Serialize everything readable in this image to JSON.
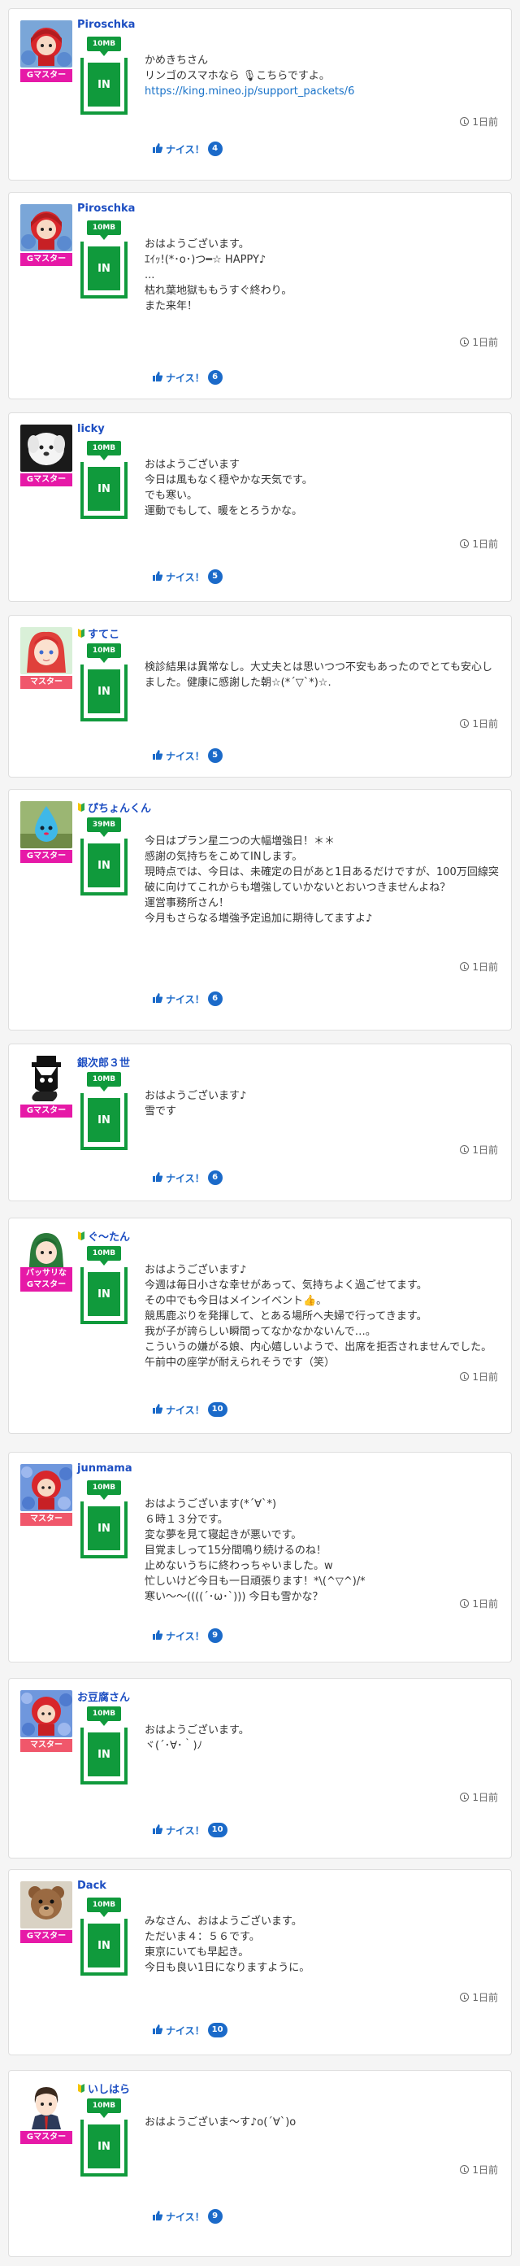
{
  "posts": [
    {
      "user": "Piroschka",
      "rank": "Gマスター",
      "packet": "10MB",
      "packet_in": "IN",
      "text": "かめきちさん\nリンゴのスマホなら 🎙こちらですよ。",
      "link": "https://king.mineo.jp/support_packets/6",
      "time": "1日前",
      "nice_label": "ナイス！",
      "nice_count": "4",
      "avatar": "red-hood-girl"
    },
    {
      "user": "Piroschka",
      "rank": "Gマスター",
      "packet": "10MB",
      "packet_in": "IN",
      "text": "おはようございます。\nｴｲｯ!(*･o･)つ━☆ HAPPY♪\n...\n枯れ葉地獄ももうすぐ終わり。\nまた来年！",
      "time": "1日前",
      "nice_label": "ナイス！",
      "nice_count": "6",
      "avatar": "red-hood-girl"
    },
    {
      "user": "licky",
      "rank": "Gマスター",
      "packet": "10MB",
      "packet_in": "IN",
      "text": "おはようございます\n今日は風もなく穏やかな天気です。\nでも寒い。\n運動でもして、暖をとろうかな。",
      "time": "1日前",
      "nice_label": "ナイス！",
      "nice_count": "5",
      "avatar": "white-dog"
    },
    {
      "user": "すてこ",
      "rank": "マスター",
      "packet": "10MB",
      "packet_in": "IN",
      "beginner": true,
      "text": "検診結果は異常なし。大丈夫とは思いつつ不安もあったのでとても安心しました。健康に感謝した朝☆(*´▽`*)☆.",
      "time": "1日前",
      "nice_label": "ナイス！",
      "nice_count": "5",
      "avatar": "red-hair-girl"
    },
    {
      "user": "ぴちょんくん",
      "rank": "Gマスター",
      "packet": "39MB",
      "packet_in": "IN",
      "beginner": true,
      "text": "今日はプラン星二つの大幅増強日！＊＊\n感謝の気持ちをこめてINします。\n現時点では、今日は、未確定の日があと1日あるだけですが、100万回線突破に向けてこれからも増強していかないとおいつきませんよね？\n運営事務所さん！\n今月もさらなる増強予定追加に期待してますよ♪",
      "time": "1日前",
      "nice_label": "ナイス！",
      "nice_count": "6",
      "avatar": "blue-drop"
    },
    {
      "user": "銀次郎３世",
      "rank": "Gマスター",
      "packet": "10MB",
      "packet_in": "IN",
      "text": "おはようございます♪\n雪です",
      "time": "1日前",
      "nice_label": "ナイス！",
      "nice_count": "6",
      "avatar": "black-cat"
    },
    {
      "user": "ぐ〜たん",
      "rank_top": "バッサリな",
      "rank": "Gマスター",
      "packet": "10MB",
      "packet_in": "IN",
      "beginner": true,
      "text": "おはようございます♪\n今週は毎日小さな幸せがあって、気持ちよく過ごせてます。\nその中でも今日はメインイベント👍。\n競馬鹿ぶりを発揮して、とある場所へ夫婦で行ってきます。\n我が子が誇らしい瞬間ってなかなかないんで…。\nこういうの嫌がる娘、内心嬉しいようで、出席を拒否されませんでした。\n午前中の座学が耐えられそうです（笑）",
      "time": "1日前",
      "nice_label": "ナイス！",
      "nice_count": "10",
      "avatar": "green-hair-girl"
    },
    {
      "user": "junmama",
      "rank": "マスター",
      "packet": "10MB",
      "packet_in": "IN",
      "text": "おはようございます(*´∀`*)\n６時１３分です。\n変な夢を見て寝起きが悪いです。\n目覚ましって15分間鳴り続けるのね！\n止めないうちに終わっちゃいました。w\n忙しいけど今日も一日頑張ります！*\\(^▽^)/*\n寒い〜〜((((´･ω･`))) 今日も雪かな？",
      "time": "1日前",
      "nice_label": "ナイス！",
      "nice_count": "9",
      "avatar": "blue-flowers-hood"
    },
    {
      "user": "お豆腐さん",
      "rank": "マスター",
      "packet": "10MB",
      "packet_in": "IN",
      "text": "おはようございます。\nヾ(´･∀･｀)ﾉ",
      "time": "1日前",
      "nice_label": "ナイス！",
      "nice_count": "10",
      "avatar": "blue-flowers-hood"
    },
    {
      "user": "Dack",
      "rank": "Gマスター",
      "packet": "10MB",
      "packet_in": "IN",
      "text": "みなさん、おはようございます。\nただいま４：５６です。\n東京にいても早起き。\n今日も良い1日になりますように。",
      "time": "1日前",
      "nice_label": "ナイス！",
      "nice_count": "10",
      "avatar": "teddy-bear"
    },
    {
      "user": "いしはら",
      "rank": "Gマスター",
      "packet": "10MB",
      "packet_in": "IN",
      "beginner": true,
      "text": "おはようございま〜す♪o(´∀`)o",
      "time": "1日前",
      "nice_label": "ナイス！",
      "nice_count": "9",
      "avatar": "suit-boy"
    }
  ],
  "colors": {
    "rank_gmaster": "#e619a7",
    "rank_master": "#f0576b",
    "packet_green": "#109a3c",
    "user_blue": "#1d4ec2",
    "nice_blue": "#1b6ac9"
  }
}
